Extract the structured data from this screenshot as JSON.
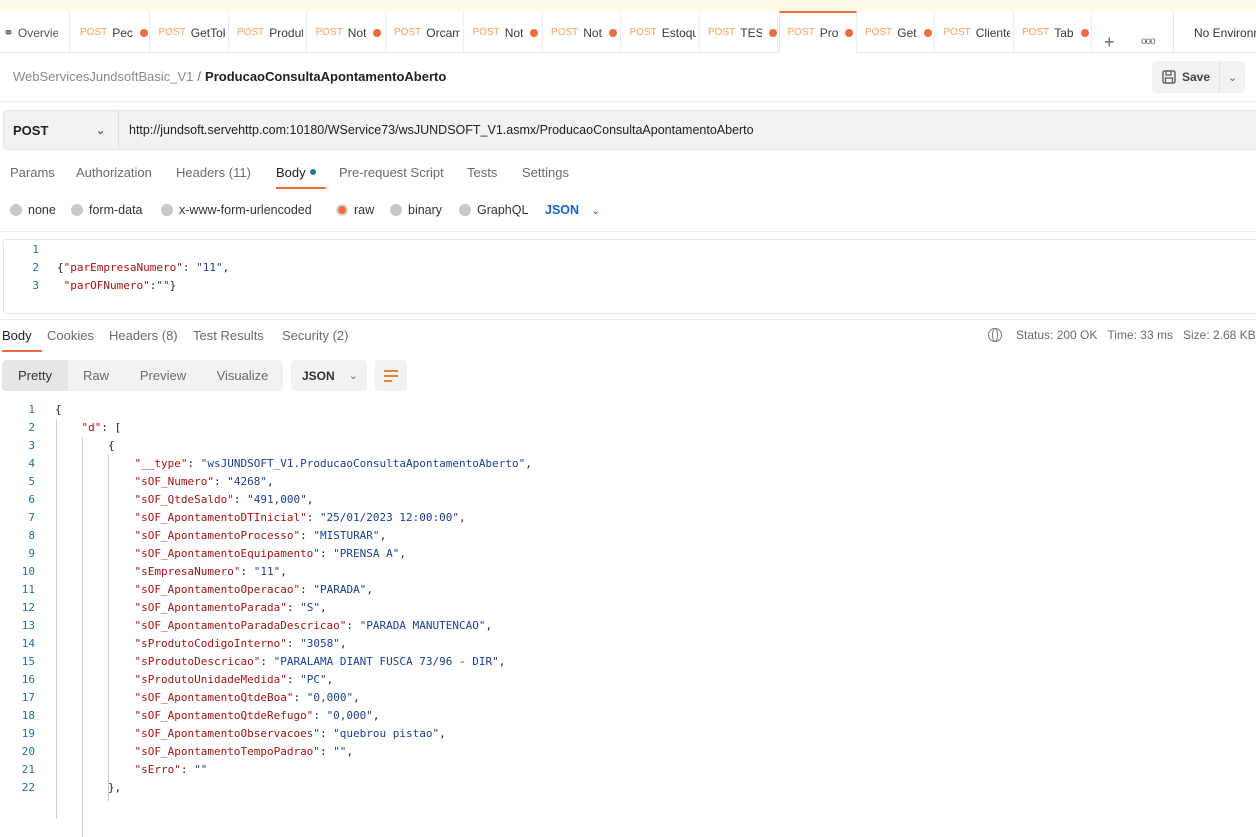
{
  "tabs": {
    "overview": "Overview",
    "items": [
      {
        "method": "POST",
        "name": "Pec",
        "unsaved": true
      },
      {
        "method": "POST",
        "name": "GetToken",
        "unsaved": false
      },
      {
        "method": "POST",
        "name": "Produto",
        "unsaved": false
      },
      {
        "method": "POST",
        "name": "Not",
        "unsaved": true
      },
      {
        "method": "POST",
        "name": "Orcamento",
        "unsaved": false
      },
      {
        "method": "POST",
        "name": "Not",
        "unsaved": true
      },
      {
        "method": "POST",
        "name": "Not",
        "unsaved": true
      },
      {
        "method": "POST",
        "name": "Estoque",
        "unsaved": false
      },
      {
        "method": "POST",
        "name": "TES",
        "unsaved": true
      },
      {
        "method": "POST",
        "name": "Pro",
        "unsaved": true,
        "active": true
      },
      {
        "method": "POST",
        "name": "Get",
        "unsaved": true
      },
      {
        "method": "POST",
        "name": "Clientes",
        "unsaved": false
      },
      {
        "method": "POST",
        "name": "Tab",
        "unsaved": true
      }
    ],
    "add": "+",
    "more": "ooo",
    "environment": "No Environment"
  },
  "breadcrumb": {
    "collection": "WebServicesJundsoftBasic_V1",
    "separator": "/",
    "request": "ProducaoConsultaApontamentoAberto"
  },
  "save": {
    "label": "Save"
  },
  "request": {
    "method": "POST",
    "url": "http://jundsoft.servehttp.com:10180/WService73/wsJUNDSOFT_V1.asmx/ProducaoConsultaApontamentoAberto",
    "tabs": [
      "Params",
      "Authorization",
      "Headers (11)",
      "Body",
      "Pre-request Script",
      "Tests",
      "Settings"
    ],
    "active_tab": "Body",
    "body_types": [
      "none",
      "form-data",
      "x-www-form-urlencoded",
      "raw",
      "binary",
      "GraphQL"
    ],
    "selected_body_type": "raw",
    "language": "JSON",
    "body_lines": [
      {
        "n": "1",
        "parts": []
      },
      {
        "n": "2",
        "parts": [
          [
            "pun",
            "{"
          ],
          [
            "key",
            "\"parEmpresaNumero\""
          ],
          [
            "pun",
            ": "
          ],
          [
            "str",
            "\"11\""
          ],
          [
            "pun",
            ","
          ]
        ]
      },
      {
        "n": "3",
        "parts": [
          [
            "pun",
            " "
          ],
          [
            "key",
            "\"parOFNumero\""
          ],
          [
            "pun",
            ":"
          ],
          [
            "str",
            "\"\""
          ],
          [
            "pun",
            "}"
          ]
        ]
      }
    ]
  },
  "response": {
    "tabs": [
      "Body",
      "Cookies",
      "Headers (8)",
      "Test Results",
      "Security (2)"
    ],
    "active_tab": "Body",
    "status": "Status: 200 OK",
    "time": "Time: 33 ms",
    "size": "Size: 2.68 KB",
    "views": [
      "Pretty",
      "Raw",
      "Preview",
      "Visualize"
    ],
    "active_view": "Pretty",
    "format": "JSON",
    "lines": [
      {
        "n": "1",
        "i": 0,
        "parts": [
          [
            "pun",
            "{"
          ]
        ]
      },
      {
        "n": "2",
        "i": 1,
        "parts": [
          [
            "key",
            "\"d\""
          ],
          [
            "pun",
            ": ["
          ]
        ]
      },
      {
        "n": "3",
        "i": 2,
        "parts": [
          [
            "pun",
            "{"
          ]
        ]
      },
      {
        "n": "4",
        "i": 3,
        "parts": [
          [
            "key",
            "\"__type\""
          ],
          [
            "pun",
            ": "
          ],
          [
            "str",
            "\"wsJUNDSOFT_V1.ProducaoConsultaApontamentoAberto\""
          ],
          [
            "pun",
            ","
          ]
        ]
      },
      {
        "n": "5",
        "i": 3,
        "parts": [
          [
            "key",
            "\"sOF_Numero\""
          ],
          [
            "pun",
            ": "
          ],
          [
            "str",
            "\"4268\""
          ],
          [
            "pun",
            ","
          ]
        ]
      },
      {
        "n": "6",
        "i": 3,
        "parts": [
          [
            "key",
            "\"sOF_QtdeSaldo\""
          ],
          [
            "pun",
            ": "
          ],
          [
            "str",
            "\"491,000\""
          ],
          [
            "pun",
            ","
          ]
        ]
      },
      {
        "n": "7",
        "i": 3,
        "parts": [
          [
            "key",
            "\"sOF_ApontamentoDTInicial\""
          ],
          [
            "pun",
            ": "
          ],
          [
            "str",
            "\"25/01/2023 12:00:00\""
          ],
          [
            "pun",
            ","
          ]
        ]
      },
      {
        "n": "8",
        "i": 3,
        "parts": [
          [
            "key",
            "\"sOF_ApontamentoProcesso\""
          ],
          [
            "pun",
            ": "
          ],
          [
            "str",
            "\"MISTURAR\""
          ],
          [
            "pun",
            ","
          ]
        ]
      },
      {
        "n": "9",
        "i": 3,
        "parts": [
          [
            "key",
            "\"sOF_ApontamentoEquipamento\""
          ],
          [
            "pun",
            ": "
          ],
          [
            "str",
            "\"PRENSA A\""
          ],
          [
            "pun",
            ","
          ]
        ]
      },
      {
        "n": "10",
        "i": 3,
        "parts": [
          [
            "key",
            "\"sEmpresaNumero\""
          ],
          [
            "pun",
            ": "
          ],
          [
            "str",
            "\"11\""
          ],
          [
            "pun",
            ","
          ]
        ]
      },
      {
        "n": "11",
        "i": 3,
        "parts": [
          [
            "key",
            "\"sOF_ApontamentoOperacao\""
          ],
          [
            "pun",
            ": "
          ],
          [
            "str",
            "\"PARADA\""
          ],
          [
            "pun",
            ","
          ]
        ]
      },
      {
        "n": "12",
        "i": 3,
        "parts": [
          [
            "key",
            "\"sOF_ApontamentoParada\""
          ],
          [
            "pun",
            ": "
          ],
          [
            "str",
            "\"S\""
          ],
          [
            "pun",
            ","
          ]
        ]
      },
      {
        "n": "13",
        "i": 3,
        "parts": [
          [
            "key",
            "\"sOF_ApontamentoParadaDescricao\""
          ],
          [
            "pun",
            ": "
          ],
          [
            "str",
            "\"PARADA MANUTENCAO\""
          ],
          [
            "pun",
            ","
          ]
        ]
      },
      {
        "n": "14",
        "i": 3,
        "parts": [
          [
            "key",
            "\"sProdutoCodigoInterno\""
          ],
          [
            "pun",
            ": "
          ],
          [
            "str",
            "\"3058\""
          ],
          [
            "pun",
            ","
          ]
        ]
      },
      {
        "n": "15",
        "i": 3,
        "parts": [
          [
            "key",
            "\"sProdutoDescricao\""
          ],
          [
            "pun",
            ": "
          ],
          [
            "str",
            "\"PARALAMA DIANT FUSCA 73/96 - DIR\""
          ],
          [
            "pun",
            ","
          ]
        ]
      },
      {
        "n": "16",
        "i": 3,
        "parts": [
          [
            "key",
            "\"sProdutoUnidadeMedida\""
          ],
          [
            "pun",
            ": "
          ],
          [
            "str",
            "\"PC\""
          ],
          [
            "pun",
            ","
          ]
        ]
      },
      {
        "n": "17",
        "i": 3,
        "parts": [
          [
            "key",
            "\"sOF_ApontamentoQtdeBoa\""
          ],
          [
            "pun",
            ": "
          ],
          [
            "str",
            "\"0,000\""
          ],
          [
            "pun",
            ","
          ]
        ]
      },
      {
        "n": "18",
        "i": 3,
        "parts": [
          [
            "key",
            "\"sOF_ApontamentoQtdeRefugo\""
          ],
          [
            "pun",
            ": "
          ],
          [
            "str",
            "\"0,000\""
          ],
          [
            "pun",
            ","
          ]
        ]
      },
      {
        "n": "19",
        "i": 3,
        "parts": [
          [
            "key",
            "\"sOF_ApontamentoObservacoes\""
          ],
          [
            "pun",
            ": "
          ],
          [
            "str",
            "\"quebrou pistao\""
          ],
          [
            "pun",
            ","
          ]
        ]
      },
      {
        "n": "20",
        "i": 3,
        "parts": [
          [
            "key",
            "\"sOF_ApontamentoTempoPadrao\""
          ],
          [
            "pun",
            ": "
          ],
          [
            "str",
            "\"\""
          ],
          [
            "pun",
            ","
          ]
        ]
      },
      {
        "n": "21",
        "i": 3,
        "parts": [
          [
            "key",
            "\"sErro\""
          ],
          [
            "pun",
            ": "
          ],
          [
            "str",
            "\"\""
          ]
        ]
      },
      {
        "n": "22",
        "i": 2,
        "parts": [
          [
            "pun",
            "},"
          ]
        ]
      }
    ]
  },
  "colors": {
    "accent": "#f26b3a",
    "key": "#a31515",
    "string": "#1c3f95",
    "link": "#1a62c2"
  }
}
